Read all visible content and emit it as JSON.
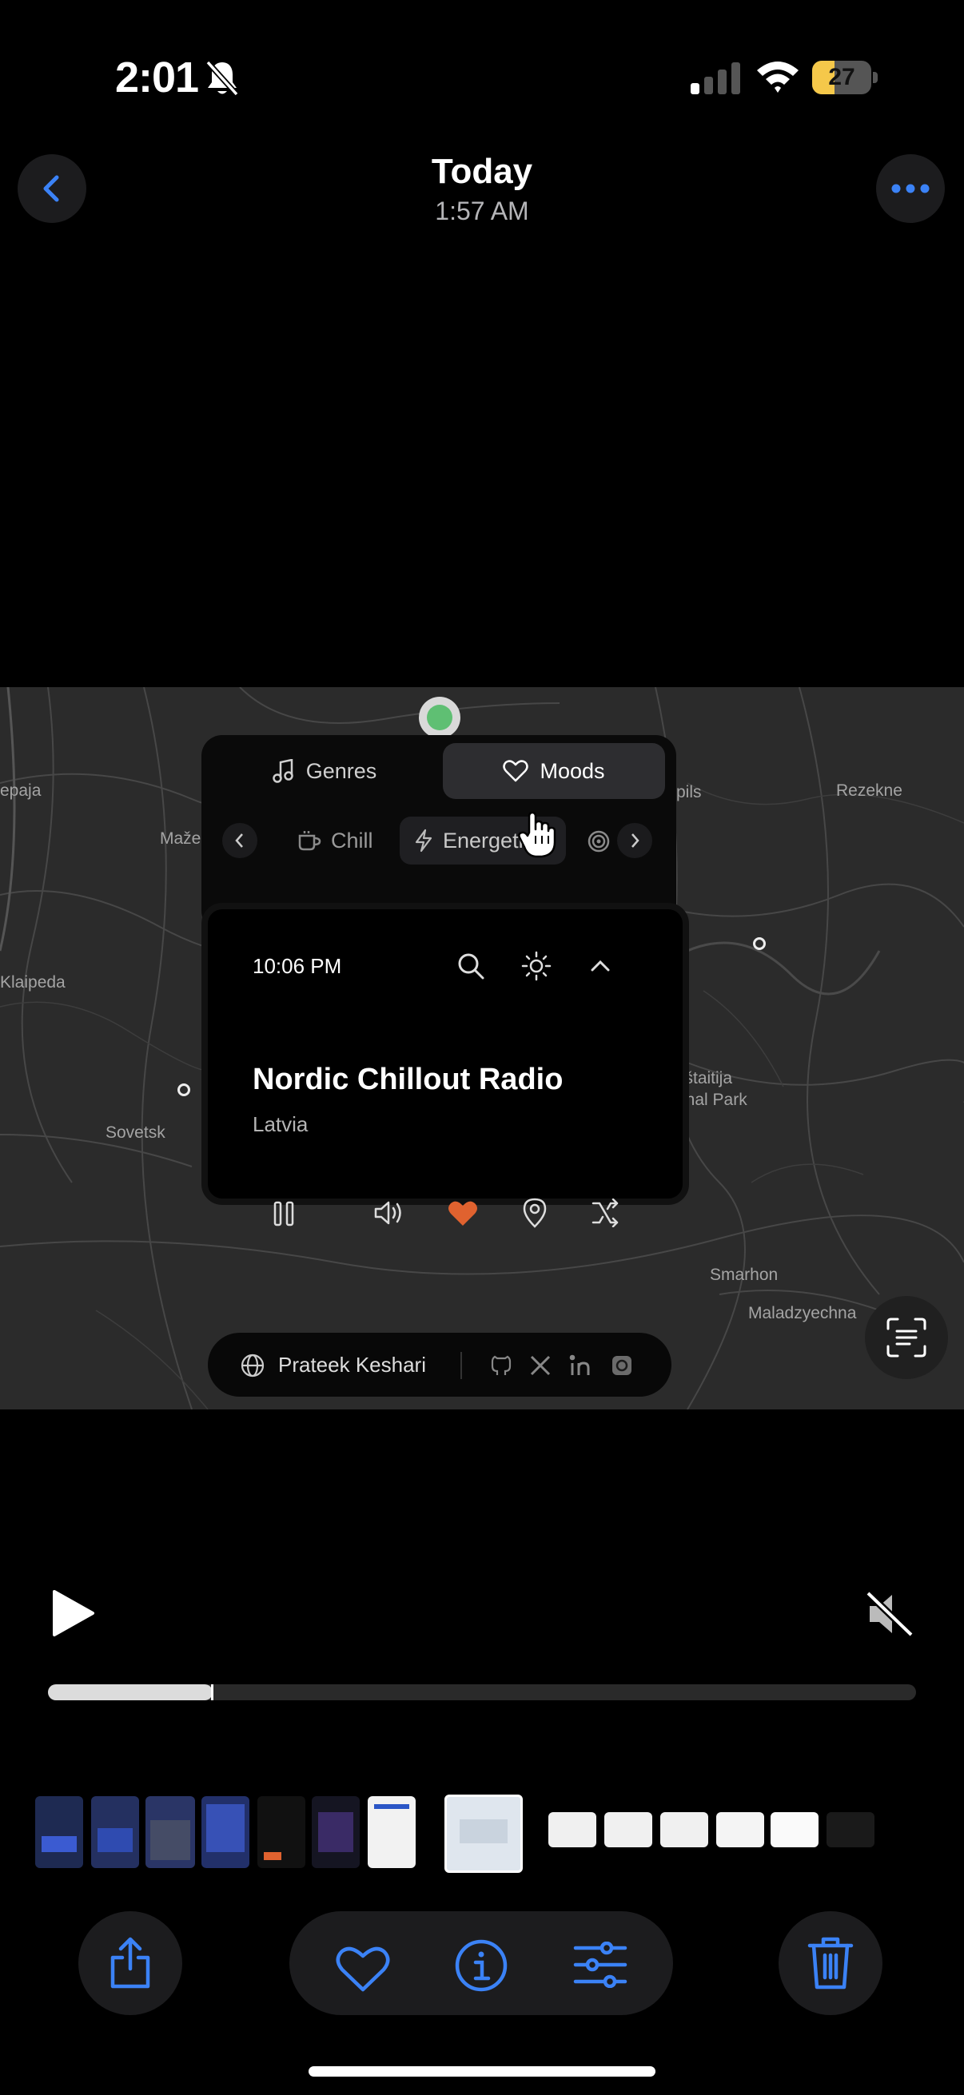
{
  "status_bar": {
    "time": "2:01",
    "battery": "27",
    "icons": [
      "bell-slash-icon",
      "cellular-signal-icon",
      "wifi-icon",
      "battery-icon"
    ]
  },
  "nav": {
    "title": "Today",
    "subtitle": "1:57 AM",
    "back_icon": "chevron-left-icon",
    "more_icon": "ellipsis-icon"
  },
  "map": {
    "places": [
      {
        "name": "epaja"
      },
      {
        "name": "Mažei"
      },
      {
        "name": "Klaipeda"
      },
      {
        "name": "Sovetsk"
      },
      {
        "name": "pils"
      },
      {
        "name": "Rezekne"
      },
      {
        "name": "kštaitija"
      },
      {
        "name": "onal Park"
      },
      {
        "name": "Smarhon"
      },
      {
        "name": "Maladzyechna"
      }
    ]
  },
  "radio_app": {
    "tabs": [
      {
        "label": "Genres",
        "icon": "music-note-icon",
        "active": false
      },
      {
        "label": "Moods",
        "icon": "heart-outline-icon",
        "active": true
      }
    ],
    "moods": [
      {
        "label": "Chill",
        "icon": "coffee-cup-icon",
        "active": false
      },
      {
        "label": "Energetic",
        "icon": "bolt-icon",
        "active": true
      },
      {
        "label": "",
        "icon": "target-icon",
        "active": false
      }
    ],
    "player": {
      "time": "10:06 PM",
      "station": "Nordic Chillout Radio",
      "country": "Latvia",
      "favorite_color": "#e0622f"
    },
    "footer": {
      "author": "Prateek Keshari",
      "links": [
        "github-icon",
        "x-icon",
        "linkedin-icon",
        "threads-icon"
      ]
    }
  },
  "video": {
    "progress_fraction": 0.19
  },
  "toolbar": {
    "items": [
      "share-icon",
      "heart-icon",
      "info-icon",
      "adjustments-icon",
      "trash-icon"
    ],
    "accent": "#3b82f6"
  }
}
